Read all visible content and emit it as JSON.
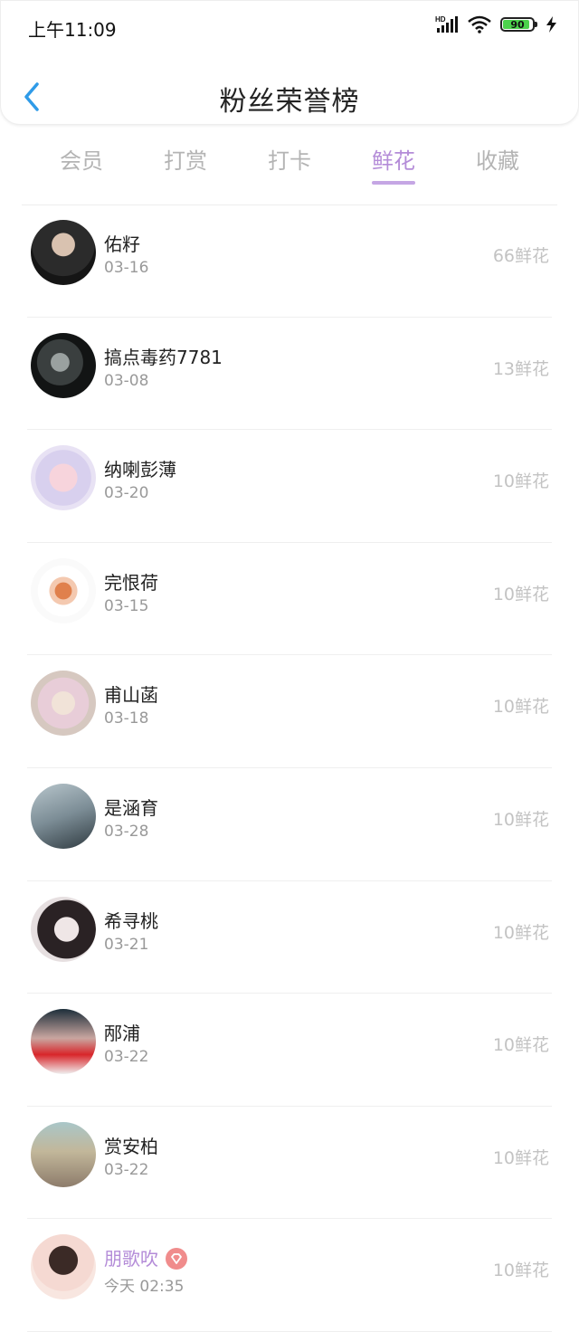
{
  "status_bar": {
    "time": "上午11:09",
    "hd": "HD",
    "battery": "90"
  },
  "header": {
    "title": "粉丝荣誉榜"
  },
  "tabs": [
    {
      "label": "会员",
      "active": false
    },
    {
      "label": "打赏",
      "active": false
    },
    {
      "label": "打卡",
      "active": false
    },
    {
      "label": "鲜花",
      "active": true
    },
    {
      "label": "收藏",
      "active": false
    }
  ],
  "rows": [
    {
      "name": "佑籽",
      "date": "03-16",
      "amount": "66鲜花"
    },
    {
      "name": "搞点毒药7781",
      "date": "03-08",
      "amount": "13鲜花"
    },
    {
      "name": "纳喇彭薄",
      "date": "03-20",
      "amount": "10鲜花"
    },
    {
      "name": "完恨荷",
      "date": "03-15",
      "amount": "10鲜花"
    },
    {
      "name": "甫山菡",
      "date": "03-18",
      "amount": "10鲜花"
    },
    {
      "name": "是涵育",
      "date": "03-28",
      "amount": "10鲜花"
    },
    {
      "name": "希寻桃",
      "date": "03-21",
      "amount": "10鲜花"
    },
    {
      "name": "邴浦",
      "date": "03-22",
      "amount": "10鲜花"
    },
    {
      "name": "赏安柏",
      "date": "03-22",
      "amount": "10鲜花"
    },
    {
      "name": "朋歌吹",
      "date": "今天 02:35",
      "amount": "10鲜花",
      "vip": true
    }
  ],
  "colors": {
    "accent": "#b48cd8",
    "back": "#2f9be8",
    "muted": "#c3c3c3"
  }
}
